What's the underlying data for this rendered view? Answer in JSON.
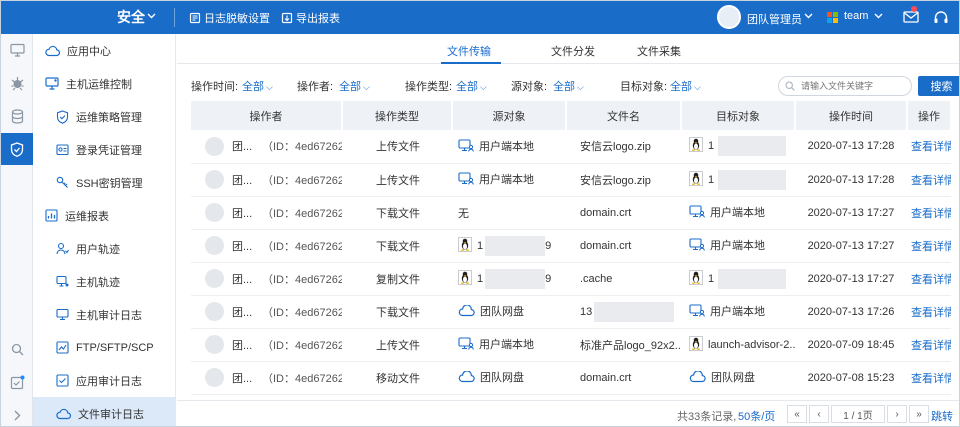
{
  "topbar": {
    "brand": "安全",
    "log_mask_settings": "日志脱敏设置",
    "export_report": "导出报表",
    "user_name": "团队管理员",
    "team_name": "team",
    "brand_color": "#1a6cc9"
  },
  "rail": [
    "monitor-icon",
    "virus-icon",
    "database-icon",
    "shield-icon",
    "search-icon",
    "checklist-icon",
    "chevron-right-icon"
  ],
  "sidebar": {
    "items": [
      {
        "label": "应用中心",
        "icon": "cloud-icon"
      },
      {
        "label": "主机运维控制",
        "icon": "host-icon"
      },
      {
        "label": "运维策略管理",
        "icon": "shield-check-icon"
      },
      {
        "label": "登录凭证管理",
        "icon": "credential-icon"
      },
      {
        "label": "SSH密钥管理",
        "icon": "key-icon"
      },
      {
        "label": "运维报表",
        "icon": "report-icon"
      },
      {
        "label": "用户轨迹",
        "icon": "user-track-icon"
      },
      {
        "label": "主机轨迹",
        "icon": "host-track-icon"
      },
      {
        "label": "主机审计日志",
        "icon": "monitor-icon"
      },
      {
        "label": "FTP/SFTP/SCP",
        "icon": "ftp-icon"
      },
      {
        "label": "应用审计日志",
        "icon": "app-log-icon"
      },
      {
        "label": "文件审计日志",
        "icon": "cloud-icon"
      }
    ]
  },
  "tabs": [
    "文件传输",
    "文件分发",
    "文件采集"
  ],
  "filters": {
    "op_time_label": "操作时间:",
    "op_user_label": "操作者:",
    "op_type_label": "操作类型:",
    "source_label": "源对象:",
    "target_label": "目标对象:",
    "all": "全部",
    "search_placeholder": "请输入文件关键字",
    "search_button": "搜索"
  },
  "table": {
    "headers": [
      "操作者",
      "操作类型",
      "源对象",
      "文件名",
      "目标对象",
      "操作时间",
      "操作"
    ],
    "rows": [
      {
        "name": "团...",
        "id": "（ID：4ed67262）",
        "type": "上传文件",
        "source": "用户端本地",
        "source_icon": "user-local-icon",
        "file": "安信云logo.zip",
        "target": "1",
        "target_icon": "linux-icon",
        "time": "2020-07-13 17:28",
        "action": "查看详情"
      },
      {
        "name": "团...",
        "id": "（ID：4ed67262）",
        "type": "上传文件",
        "source": "用户端本地",
        "source_icon": "user-local-icon",
        "file": "安信云logo.zip",
        "target": "1",
        "target_icon": "linux-icon",
        "time": "2020-07-13 17:28",
        "action": "查看详情"
      },
      {
        "name": "团...",
        "id": "（ID：4ed67262）",
        "type": "下载文件",
        "source": "无",
        "source_icon": "",
        "file": "domain.crt",
        "target": "用户端本地",
        "target_icon": "user-local-icon",
        "time": "2020-07-13 17:27",
        "action": "查看详情"
      },
      {
        "name": "团...",
        "id": "（ID：4ed67262）",
        "type": "下载文件",
        "source": "1",
        "source_tail": "9",
        "source_icon": "linux-icon",
        "file": "domain.crt",
        "target": "用户端本地",
        "target_icon": "user-local-icon",
        "time": "2020-07-13 17:27",
        "action": "查看详情"
      },
      {
        "name": "团...",
        "id": "（ID：4ed67262）",
        "type": "复制文件",
        "source": "1",
        "source_tail": "9",
        "source_icon": "linux-icon",
        "file": ".cache",
        "target": "1",
        "target_icon": "linux-icon",
        "time": "2020-07-13 17:27",
        "action": "查看详情"
      },
      {
        "name": "团...",
        "id": "（ID：4ed67262）",
        "type": "下载文件",
        "source": "团队网盘",
        "source_icon": "cloud-disk-icon",
        "file": "13",
        "target": "用户端本地",
        "target_icon": "user-local-icon",
        "time": "2020-07-13 17:26",
        "action": "查看详情"
      },
      {
        "name": "团...",
        "id": "（ID：4ed67262）",
        "type": "上传文件",
        "source": "用户端本地",
        "source_icon": "user-local-icon",
        "file": "标准产品logo_92x2...",
        "target": "launch-advisor-2...",
        "target_icon": "linux-icon",
        "time": "2020-07-09 18:45",
        "action": "查看详情"
      },
      {
        "name": "团...",
        "id": "（ID：4ed67262）",
        "type": "移动文件",
        "source": "团队网盘",
        "source_icon": "cloud-disk-icon",
        "file": "domain.crt",
        "target": "团队网盘",
        "target_icon": "cloud-disk-icon",
        "time": "2020-07-08 15:23",
        "action": "查看详情"
      }
    ]
  },
  "pager": {
    "total": "共33条记录,",
    "per_page": "50条/页",
    "page": "1 / 1页",
    "jump": "跳转"
  }
}
